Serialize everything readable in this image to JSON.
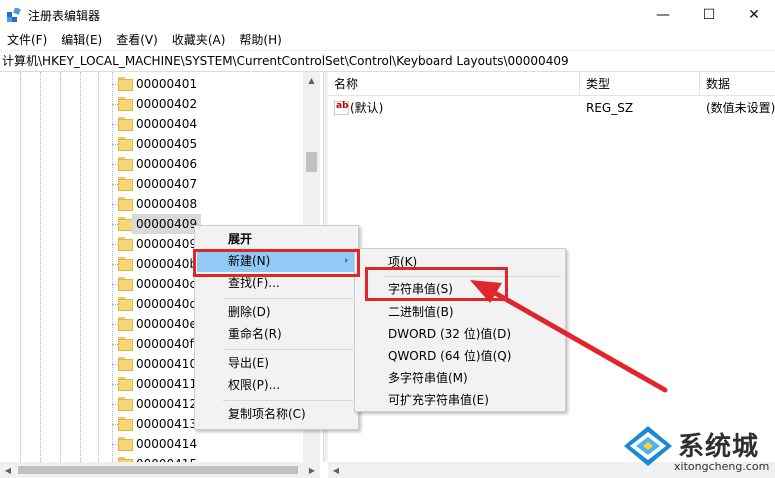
{
  "window": {
    "title": "注册表编辑器",
    "minimize_glyph": "—",
    "maximize_glyph": "☐",
    "close_glyph": "✕",
    "icon": "regedit-icon"
  },
  "menubar": [
    "文件(F)",
    "编辑(E)",
    "查看(V)",
    "收藏夹(A)",
    "帮助(H)"
  ],
  "address": "计算机\\HKEY_LOCAL_MACHINE\\SYSTEM\\CurrentControlSet\\Control\\Keyboard Layouts\\00000409",
  "tree": {
    "items": [
      "00000401",
      "00000402",
      "00000404",
      "00000405",
      "00000406",
      "00000407",
      "00000408",
      "00000409",
      "00000409a",
      "0000040b",
      "0000040c",
      "0000040d",
      "0000040e",
      "0000040f",
      "00000410",
      "00000411",
      "00000412",
      "00000413",
      "00000414",
      "00000415"
    ],
    "selected": "00000409"
  },
  "list": {
    "headers": {
      "name": "名称",
      "type": "类型",
      "data": "数据"
    },
    "rows": [
      {
        "name": "(默认)",
        "type": "REG_SZ",
        "data": "(数值未设置)"
      }
    ]
  },
  "context_menu": {
    "expand": "展开",
    "new": "新建(N)",
    "find": "查找(F)...",
    "delete": "删除(D)",
    "rename": "重命名(R)",
    "export": "导出(E)",
    "permissions": "权限(P)...",
    "copy_key_name": "复制项名称(C)",
    "submenu_glyph": "›"
  },
  "submenu": {
    "key": "项(K)",
    "string_value": "字符串值(S)",
    "binary_value": "二进制值(B)",
    "dword_value": "DWORD (32 位)值(D)",
    "qword_value": "QWORD (64 位)值(Q)",
    "multi_string_value": "多字符串值(M)",
    "expandable_string_value": "可扩充字符串值(E)"
  },
  "watermark": {
    "title": "系统城",
    "url": "xitongcheng.com"
  },
  "colors": {
    "highlight": "#e0262b",
    "hover": "#91c9f7",
    "menu_bg": "#f2f2f2"
  }
}
